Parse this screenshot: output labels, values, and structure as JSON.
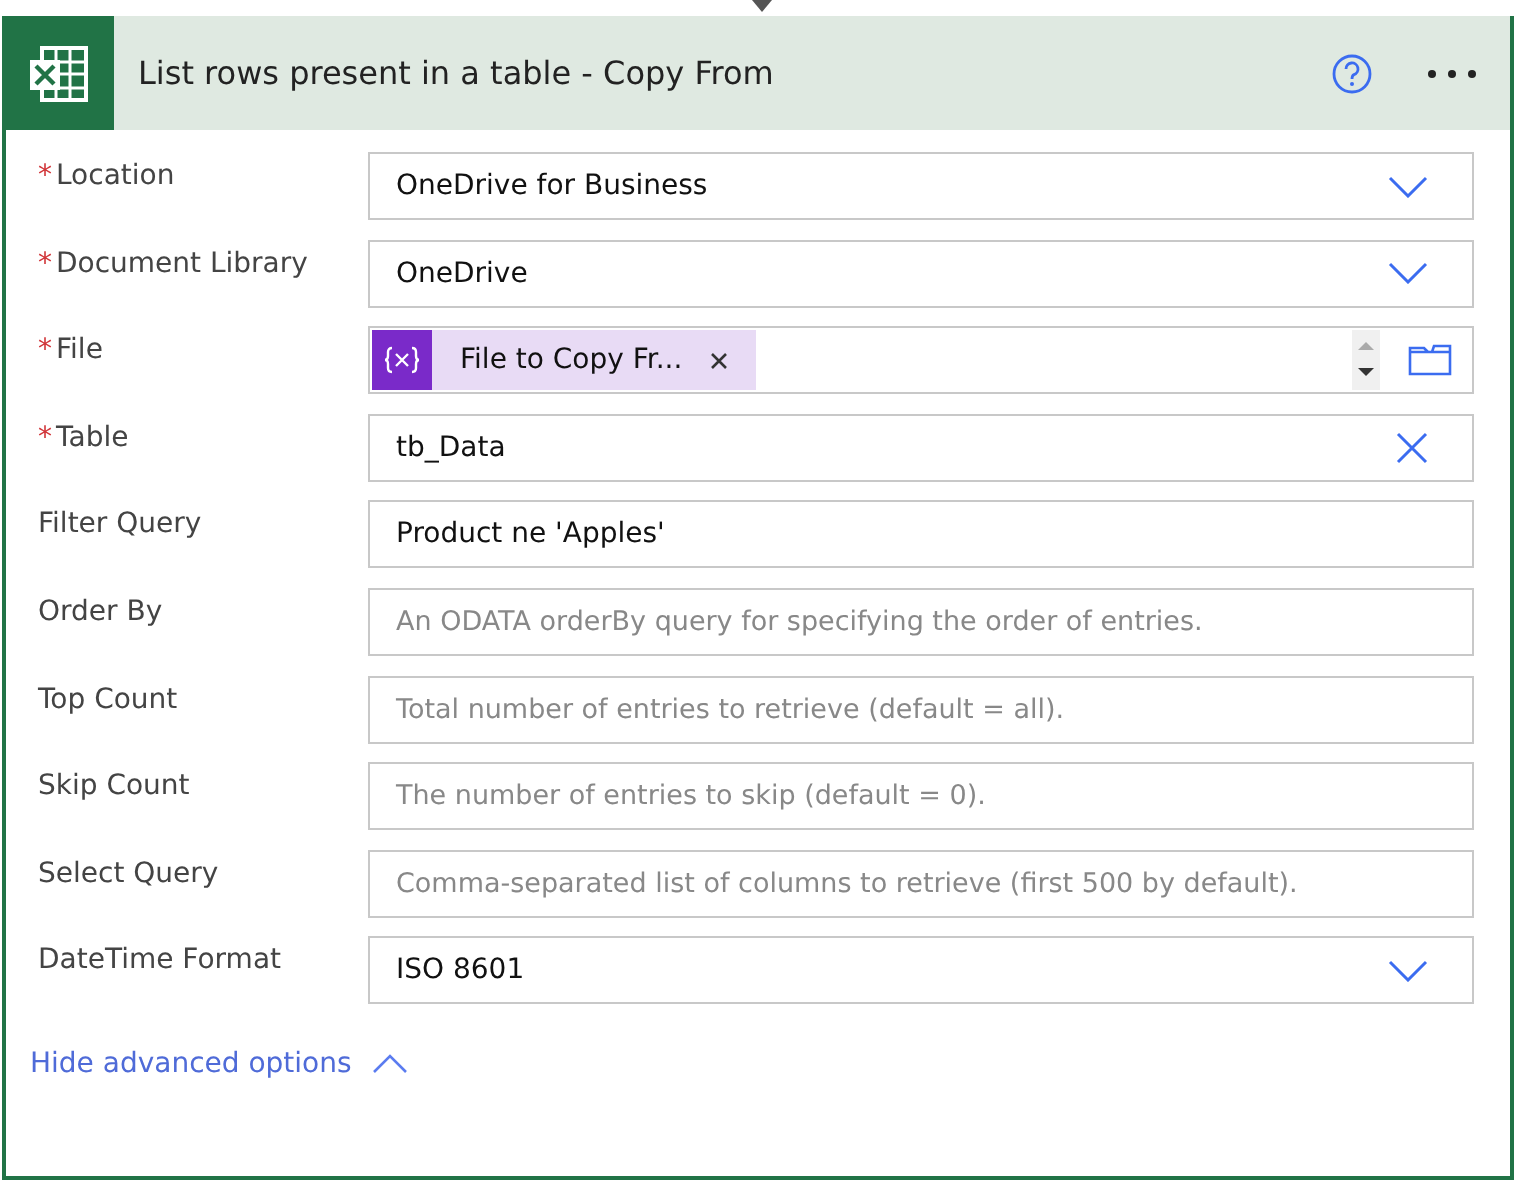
{
  "header": {
    "title": "List rows present in a table - Copy From"
  },
  "fields": [
    {
      "label": "Location",
      "marker": "*",
      "kind": "dropdown",
      "value": "OneDrive for Business"
    },
    {
      "label": "Document Library",
      "marker": "*",
      "kind": "dropdown",
      "value": "OneDrive"
    },
    {
      "label": "File",
      "marker": "*",
      "kind": "token",
      "token": "File to Copy Fr..."
    },
    {
      "label": "Table",
      "marker": "*",
      "kind": "clearable",
      "value": "tb_Data"
    },
    {
      "label": "Filter Query",
      "kind": "text",
      "value": "Product ne 'Apples'"
    },
    {
      "label": "Order By",
      "kind": "text",
      "placeholder": "An ODATA orderBy query for specifying the order of entries."
    },
    {
      "label": "Top Count",
      "kind": "text",
      "placeholder": "Total number of entries to retrieve (default = all)."
    },
    {
      "label": "Skip Count",
      "kind": "text",
      "placeholder": "The number of entries to skip (default = 0)."
    },
    {
      "label": "Select Query",
      "kind": "text",
      "placeholder": "Comma-separated list of columns to retrieve (first 500 by default)."
    },
    {
      "label": "DateTime Format",
      "kind": "dropdown",
      "value": "ISO 8601"
    }
  ],
  "advanced_link": {
    "label": "Hide advanced options",
    "expanded": true
  }
}
